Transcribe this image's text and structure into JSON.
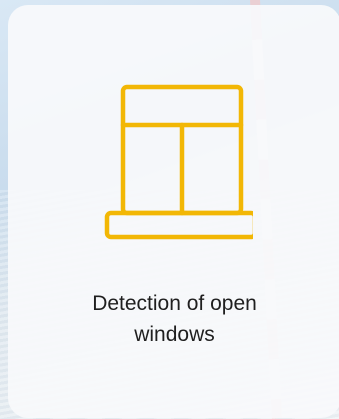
{
  "card": {
    "icon": "window-icon",
    "caption_line1": "Detection of open",
    "caption_line2": "windows"
  },
  "colors": {
    "icon_stroke": "#f2b705",
    "card_background": "#f8f9fb",
    "text": "#1f1f1f"
  }
}
